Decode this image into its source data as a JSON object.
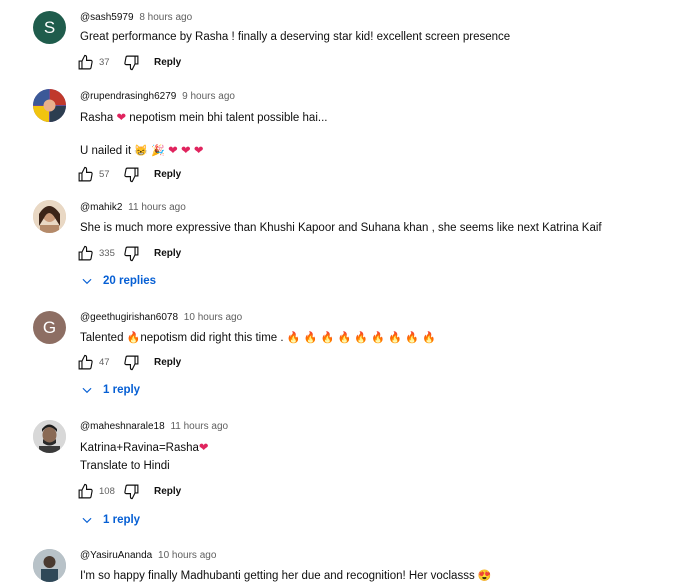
{
  "colors": {
    "reply_link": "#065fd4",
    "muted": "#606060"
  },
  "comments": [
    {
      "author": "@sash5979",
      "time": "8 hours ago",
      "avatar_letter": "S",
      "avatar_color": "#1f5c4c",
      "text": "Great performance by Rasha ! finally a deserving star kid! excellent screen presence",
      "likes": "37",
      "reply_label": "Reply"
    },
    {
      "author": "@rupendrasingh6279",
      "time": "9 hours ago",
      "text_line1": "Rasha",
      "text_line1_after": " nepotism mein bhi talent possible hai...",
      "text_line2": "U nailed it",
      "likes": "57",
      "reply_label": "Reply"
    },
    {
      "author": "@mahik2",
      "time": "11 hours ago",
      "text": "She is much more expressive than Khushi Kapoor and Suhana khan , she seems like next Katrina Kaif",
      "likes": "335",
      "reply_label": "Reply",
      "replies_label": "20 replies"
    },
    {
      "author": "@geethugirishan6078",
      "time": "10 hours ago",
      "avatar_letter": "G",
      "avatar_color": "#8d6e63",
      "text_before": "Talented",
      "text_after": "nepotism did right this time .",
      "likes": "47",
      "reply_label": "Reply",
      "replies_label": "1 reply"
    },
    {
      "author": "@maheshnarale18",
      "time": "11 hours ago",
      "text_line1": "Katrina+Ravina=Rasha",
      "text_line2": "Translate to Hindi",
      "likes": "108",
      "reply_label": "Reply",
      "replies_label": "1 reply"
    },
    {
      "author": "@YasiruAnanda",
      "time": "10 hours ago",
      "text": "I'm so happy finally Madhubanti getting her due and recognition! Her voclasss"
    }
  ]
}
